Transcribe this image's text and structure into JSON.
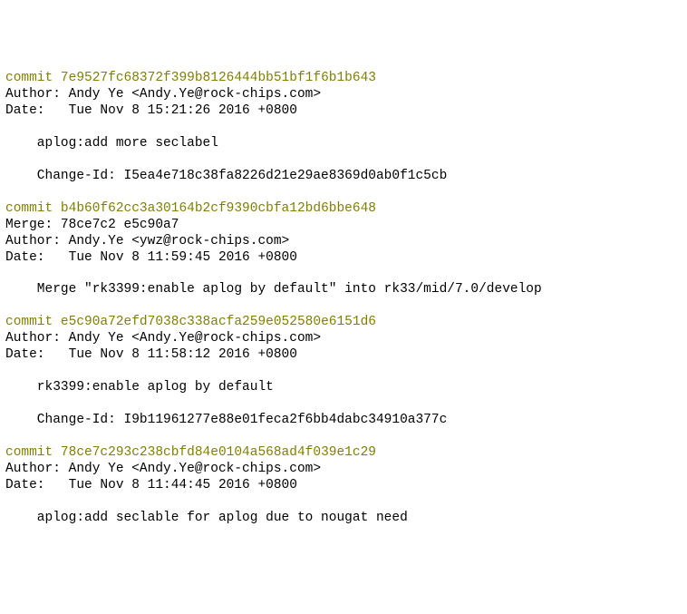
{
  "commits": [
    {
      "label": "commit ",
      "hash": "7e9527fc68372f399b8126444bb51bf1f6b1b643",
      "lines": [
        "Author: Andy Ye <Andy.Ye@rock-chips.com>",
        "Date:   Tue Nov 8 15:21:26 2016 +0800"
      ],
      "body": [
        "    aplog:add more seclabel",
        "",
        "    Change-Id: I5ea4e718c38fa8226d21e29ae8369d0ab0f1c5cb"
      ]
    },
    {
      "label": "commit ",
      "hash": "b4b60f62cc3a30164b2cf9390cbfa12bd6bbe648",
      "lines": [
        "Merge: 78ce7c2 e5c90a7",
        "Author: Andy.Ye <ywz@rock-chips.com>",
        "Date:   Tue Nov 8 11:59:45 2016 +0800"
      ],
      "body": [
        "    Merge \"rk3399:enable aplog by default\" into rk33/mid/7.0/develop"
      ]
    },
    {
      "label": "commit ",
      "hash": "e5c90a72efd7038c338acfa259e052580e6151d6",
      "lines": [
        "Author: Andy Ye <Andy.Ye@rock-chips.com>",
        "Date:   Tue Nov 8 11:58:12 2016 +0800"
      ],
      "body": [
        "    rk3399:enable aplog by default",
        "",
        "    Change-Id: I9b11961277e88e01feca2f6bb4dabc34910a377c"
      ]
    },
    {
      "label": "commit ",
      "hash": "78ce7c293c238cbfd84e0104a568ad4f039e1c29",
      "lines": [
        "Author: Andy Ye <Andy.Ye@rock-chips.com>",
        "Date:   Tue Nov 8 11:44:45 2016 +0800"
      ],
      "body": [
        "    aplog:add seclable for aplog due to nougat need"
      ]
    }
  ]
}
